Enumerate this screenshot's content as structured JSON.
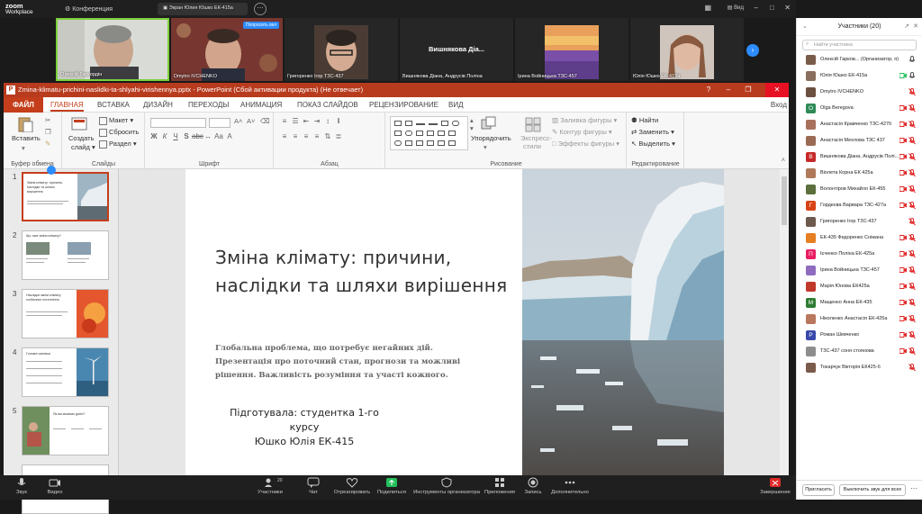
{
  "app": {
    "brand_top": "zoom",
    "brand_bottom": "Workplace"
  },
  "topbar": {
    "meeting_label": "Конференция",
    "share_pill": "Экран Юлия Юшко ЕК-415а",
    "view_label": "Вид"
  },
  "video_strip": {
    "tiles": [
      {
        "caption": "Олексій Гаркордін"
      },
      {
        "caption": "Dmytro IVCHENKO",
        "badge": "Попросить вкл"
      },
      {
        "caption": "Григоренко Ігор ТЗС-437"
      },
      {
        "caption": "Вишнякова Діана, Андрусів Поліна",
        "name_only": "Вишнякова Діа..."
      },
      {
        "caption": "Ірина Войницька ТЗС-457"
      },
      {
        "caption": "Юлія Юшко ЕК-415а"
      }
    ]
  },
  "ppt": {
    "window_title": "Zmina-klimatu-prichini-naslidki-ta-shlyahi-virishennya.pptx - PowerPoint (Сбой активации продукта) (Не отвечает)",
    "tabs": [
      "ФАЙЛ",
      "ГЛАВНАЯ",
      "ВСТАВКА",
      "ДИЗАЙН",
      "ПЕРЕХОДЫ",
      "АНИМАЦИЯ",
      "ПОКАЗ СЛАЙДОВ",
      "РЕЦЕНЗИРОВАНИЕ",
      "ВИД"
    ],
    "signin": "Вход",
    "ribbon": {
      "paste": "Вставить",
      "clipboard_label": "Буфер обмена",
      "new_slide_1": "Создать",
      "new_slide_2": "слайд",
      "layout": "Макет",
      "reset": "Сбросить",
      "section": "Раздел",
      "slides_label": "Слайды",
      "font_label": "Шрифт",
      "paragraph_label": "Абзац",
      "arrange": "Упорядочить",
      "quick_styles_1": "Экспресс-",
      "quick_styles_2": "стили",
      "shape_fill": "Заливка фигуры",
      "shape_outline": "Контур фигуры",
      "shape_effects": "Эффекты фигуры",
      "drawing_label": "Рисование",
      "find": "Найти",
      "replace": "Заменить",
      "select": "Выделить",
      "editing_label": "Редактирование"
    },
    "thumb_numbers": [
      "1",
      "2",
      "3",
      "4",
      "5"
    ],
    "thumb1_title": "Зміна клімату: причини, наслідки та шляхи вирішення",
    "thumb2_title": "Що таке зміна клімату?",
    "thumb3_title": "Наслідки зміни клімату: глобальне потепління",
    "thumb4_title": "Головні чинники",
    "thumb5_title": "Як ми можемо діяти?",
    "slide": {
      "title": "Зміна клімату: причини, наслідки та шляхи вирішення",
      "subtitle": "Глобальна проблема, що потребує негайних дій. Презентація про поточний стан, прогнози та можливі рішення. Важливість розуміння та участі кожного.",
      "author_1": "Підготувала: студентка 1-го курсу",
      "author_2": "Юшко Юлія ЕК-415"
    }
  },
  "participants": {
    "header": "Участники (20)",
    "search_placeholder": "Найти участника",
    "list": [
      {
        "name": "Олексій Гарков... (Организатор, я)",
        "color": "#7a5c4a",
        "letter": "",
        "muted": false,
        "video": false
      },
      {
        "name": "Юлія Юшко ЕК-415а",
        "color": "#8a6f5e",
        "letter": "",
        "muted": false,
        "video": true
      },
      {
        "name": "Dmytro IVCHENKO",
        "color": "#6b4f3f",
        "letter": "",
        "muted": true,
        "video": false
      },
      {
        "name": "Olga Beregova",
        "color": "#2e8b57",
        "letter": "O",
        "muted": true,
        "video": true
      },
      {
        "name": "Анастасія Кравченко ТЗС-427б",
        "color": "#a9705d",
        "letter": "",
        "muted": true,
        "video": true
      },
      {
        "name": "Анастасія Мехлова ТЗС 437",
        "color": "#9a6a55",
        "letter": "",
        "muted": true,
        "video": true
      },
      {
        "name": "Вишнякова Діана, Андрусів Полі...",
        "color": "#c62828",
        "letter": "В",
        "muted": true,
        "video": true
      },
      {
        "name": "Віолета Корна ЕК 425а",
        "color": "#b07a5a",
        "letter": "",
        "muted": true,
        "video": true
      },
      {
        "name": "Волонтіров Михайло ЕК-455",
        "color": "#5c6f3c",
        "letter": "",
        "muted": true,
        "video": true
      },
      {
        "name": "Гордеєва Варвара ТЗС-427а",
        "color": "#d84315",
        "letter": "Г",
        "muted": true,
        "video": true
      },
      {
        "name": "Григоренко Ігор ТЗС-437",
        "color": "#6d5a4c",
        "letter": "",
        "muted": true,
        "video": false
      },
      {
        "name": "ЕК-435 Федоренко Сніжана",
        "color": "#e67e22",
        "letter": "",
        "muted": true,
        "video": true
      },
      {
        "name": "Ієченко Поліна ЕК-425а",
        "color": "#e91e63",
        "letter": "П",
        "muted": true,
        "video": true
      },
      {
        "name": "Ірина Войницька ТЗС-457",
        "color": "#8e6bbf",
        "letter": "",
        "muted": true,
        "video": true
      },
      {
        "name": "Марія Юнова ЕК425а",
        "color": "#c0392b",
        "letter": "",
        "muted": true,
        "video": true
      },
      {
        "name": "Мащенко Анна ЕК-435",
        "color": "#2e7d32",
        "letter": "М",
        "muted": true,
        "video": true
      },
      {
        "name": "Ніколенко Анастасія ЕК-425а",
        "color": "#b9775d",
        "letter": "",
        "muted": true,
        "video": true
      },
      {
        "name": "Роман Шевченко",
        "color": "#3949ab",
        "letter": "Р",
        "muted": true,
        "video": true
      },
      {
        "name": "ТЗС-437 соня стоянова",
        "color": "#8d8d8d",
        "letter": "",
        "muted": true,
        "video": true
      },
      {
        "name": "Токарчук Вікторія ЕК425-б",
        "color": "#7b5b4b",
        "letter": "",
        "muted": true,
        "video": false
      }
    ],
    "invite": "Пригласить",
    "mute_all": "Выключить звук для всех"
  },
  "bottombar": {
    "audio": "Звук",
    "video": "Видео",
    "participants": "Участники",
    "participants_count": "20",
    "chat": "Чат",
    "react": "Отреагировать",
    "share": "Поделиться",
    "host_tools": "Инструменты организатора",
    "apps": "Приложения",
    "record": "Запись",
    "more": "Дополнительно",
    "end": "Завершение"
  },
  "colors": {
    "ppt_accent": "#c43e1c",
    "zoom_blue": "#2d8cff",
    "muted_red": "#e02828",
    "active_green": "#7cd13b"
  }
}
